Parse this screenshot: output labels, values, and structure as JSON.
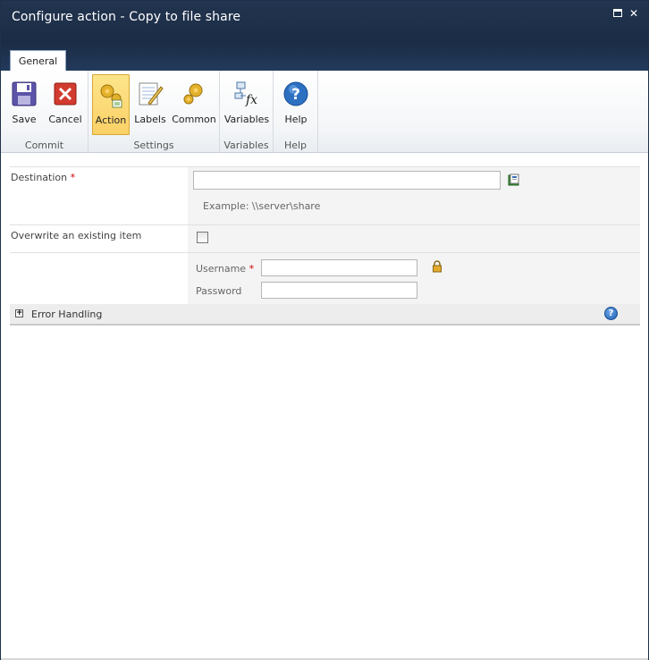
{
  "window": {
    "title": "Configure action - Copy to file share",
    "maximize_icon": "maximize-icon",
    "close_icon": "close-icon",
    "close_glyph": "✕"
  },
  "tabs": [
    {
      "label": "General",
      "selected": true
    }
  ],
  "ribbon": {
    "groups": [
      {
        "label": "Commit",
        "buttons": [
          {
            "label": "Save",
            "icon": "floppy-disk-icon"
          },
          {
            "label": "Cancel",
            "icon": "red-x-icon"
          }
        ]
      },
      {
        "label": "Settings",
        "buttons": [
          {
            "label": "Action",
            "icon": "gears-page-icon",
            "active": true
          },
          {
            "label": "Labels",
            "icon": "notepad-pencil-icon"
          },
          {
            "label": "Common",
            "icon": "gears-icon"
          }
        ]
      },
      {
        "label": "Variables",
        "buttons": [
          {
            "label": "Variables",
            "icon": "fx-function-icon"
          }
        ]
      },
      {
        "label": "Help",
        "buttons": [
          {
            "label": "Help",
            "icon": "question-icon"
          }
        ]
      }
    ]
  },
  "form": {
    "destination": {
      "label": "Destination",
      "required_marker": "*",
      "value": "",
      "example": "Example: \\\\server\\share",
      "lookup_icon": "address-book-icon"
    },
    "overwrite": {
      "label": "Overwrite an existing item",
      "checked": false
    },
    "credentials": {
      "username_label": "Username",
      "username_required": "*",
      "username_value": "",
      "password_label": "Password",
      "password_value": "",
      "lock_icon": "padlock-icon"
    },
    "error_handling": {
      "expander_glyph": "+",
      "label": "Error Handling",
      "help_glyph": "?",
      "help_icon": "help-circle-icon"
    }
  },
  "colors": {
    "title_bar": "#1b2c45",
    "active_button": "#fbd167",
    "required": "#cc0000"
  }
}
